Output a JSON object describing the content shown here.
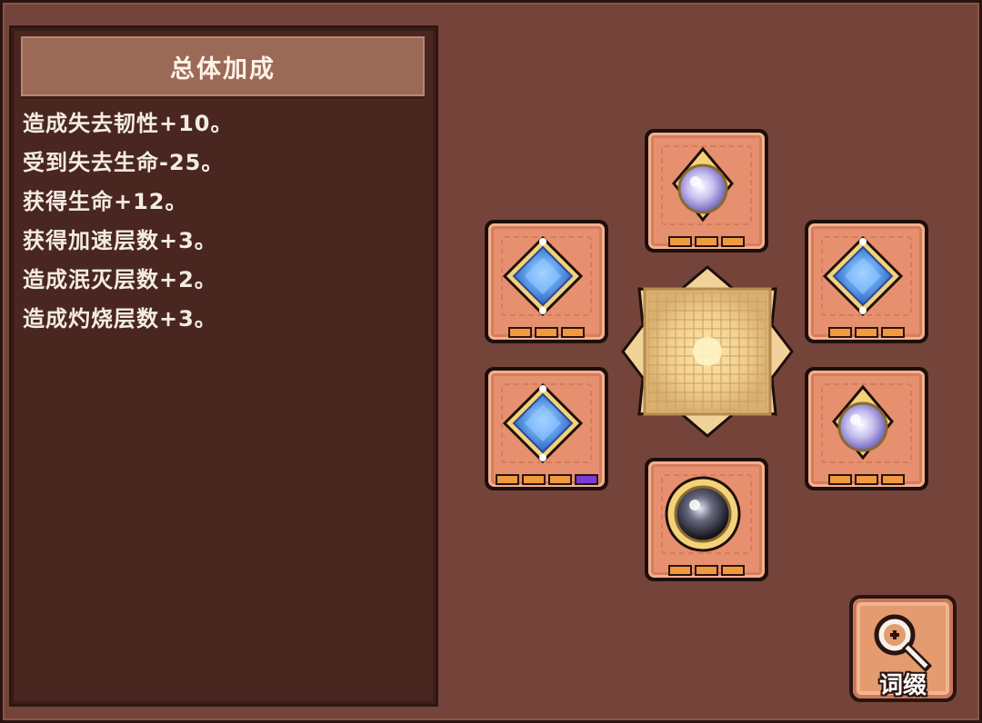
{
  "panel": {
    "title": "总体加成",
    "bonuses": [
      "造成失去韧性+10。",
      "受到失去生命-25。",
      "获得生命+12。",
      "获得加速层数+3。",
      "造成泯灭层数+2。",
      "造成灼烧层数+3。"
    ]
  },
  "slots": [
    {
      "position": "top",
      "gem": "purple-teardrop-gem",
      "pips": [
        "orange",
        "orange",
        "orange"
      ]
    },
    {
      "position": "upper-left",
      "gem": "blue-square-gem",
      "pips": [
        "orange",
        "orange",
        "orange"
      ]
    },
    {
      "position": "upper-right",
      "gem": "blue-square-gem",
      "pips": [
        "orange",
        "orange",
        "orange"
      ]
    },
    {
      "position": "lower-left",
      "gem": "blue-square-gem",
      "pips": [
        "orange",
        "orange",
        "orange",
        "purple"
      ]
    },
    {
      "position": "lower-right",
      "gem": "purple-teardrop-gem",
      "pips": [
        "orange",
        "orange",
        "orange"
      ]
    },
    {
      "position": "bottom",
      "gem": "dark-orb-gem",
      "pips": [
        "orange",
        "orange",
        "orange"
      ]
    }
  ],
  "affix_button": {
    "label": "词缀",
    "icon": "magnifier-icon"
  },
  "colors": {
    "background": "#74443a",
    "panel": "#4a2620",
    "header": "#9b6a56",
    "slot": "#e6906f",
    "pip_orange": "#f09a3c",
    "pip_purple": "#7a3bd6"
  }
}
